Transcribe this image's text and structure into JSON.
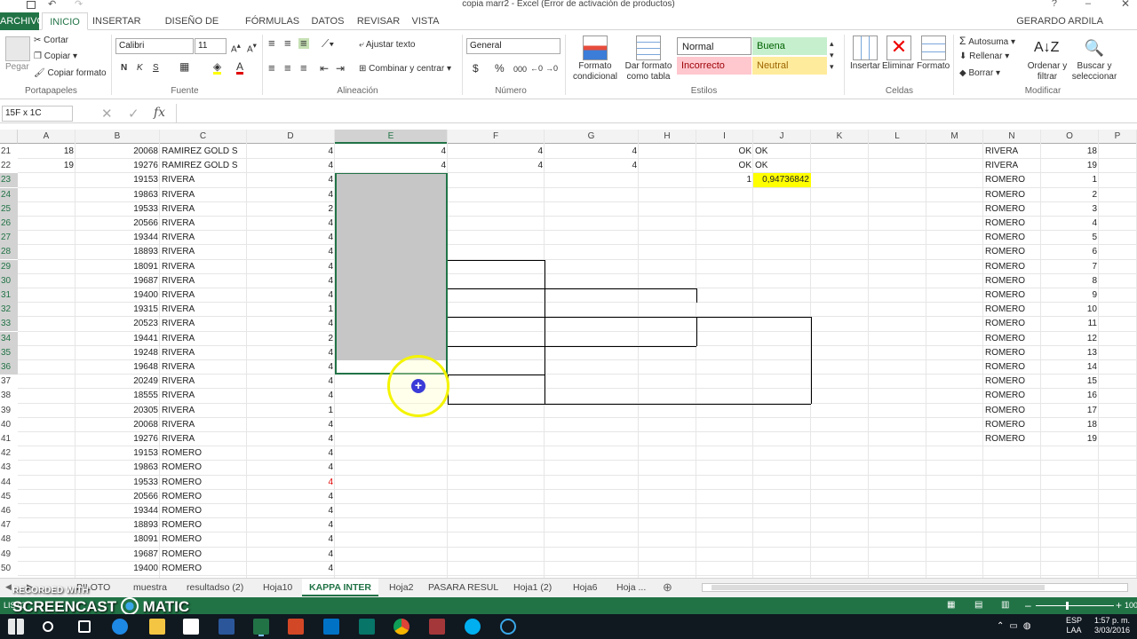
{
  "window": {
    "title": "copia marr2 - Excel (Error de activación de productos)",
    "user": "GERARDO ARDILA"
  },
  "tabs": [
    "ARCHIVO",
    "INICIO",
    "INSERTAR",
    "DISEÑO DE PÁGINA",
    "FÓRMULAS",
    "DATOS",
    "REVISAR",
    "VISTA"
  ],
  "ribbon": {
    "clipboard": {
      "paste": "Pegar",
      "cut": "Cortar",
      "copy": "Copiar",
      "format_painter": "Copiar formato",
      "label": "Portapapeles"
    },
    "font": {
      "name": "Calibri",
      "size": "11",
      "bold": "N",
      "italic": "K",
      "underline": "S",
      "label": "Fuente"
    },
    "alignment": {
      "wrap": "Ajustar texto",
      "merge": "Combinar y centrar",
      "label": "Alineación"
    },
    "number": {
      "format": "General",
      "currency": "$",
      "percent": "%",
      "thousands": "000",
      "label": "Número"
    },
    "styles": {
      "cond_format": "Formato condicional",
      "table_format": "Dar formato como tabla",
      "normal": "Normal",
      "good": "Buena",
      "bad": "Incorrecto",
      "neutral": "Neutral",
      "label": "Estilos"
    },
    "cells": {
      "insert": "Insertar",
      "delete": "Eliminar",
      "format": "Formato",
      "label": "Celdas"
    },
    "editing": {
      "autosum": "Autosuma",
      "fill": "Rellenar",
      "clear": "Borrar",
      "sort": "Ordenar y filtrar",
      "find": "Buscar y seleccionar",
      "label": "Modificar"
    }
  },
  "formula_bar": {
    "name_box": "15F x 1C",
    "fx": "fx",
    "content": ""
  },
  "columns": [
    "A",
    "B",
    "C",
    "D",
    "E",
    "F",
    "G",
    "H",
    "I",
    "J",
    "K",
    "L",
    "M",
    "N",
    "O",
    "P"
  ],
  "rows": [
    {
      "r": "21",
      "A": "18",
      "B": "20068",
      "C": "RAMIREZ GOLD S",
      "D": "4",
      "E": "4",
      "F": "4",
      "G": "4",
      "I": "OK",
      "J": "OK",
      "N": "RIVERA",
      "O": "18"
    },
    {
      "r": "22",
      "A": "19",
      "B": "19276",
      "C": "RAMIREZ GOLD S",
      "D": "4",
      "E": "4",
      "F": "4",
      "G": "4",
      "I": "OK",
      "J": "OK",
      "N": "RIVERA",
      "O": "19"
    },
    {
      "r": "23",
      "B": "19153",
      "C": "RIVERA",
      "D": "4",
      "I": "1",
      "J": "0,94736842",
      "N": "ROMERO",
      "O": "1"
    },
    {
      "r": "24",
      "B": "19863",
      "C": "RIVERA",
      "D": "4",
      "N": "ROMERO",
      "O": "2"
    },
    {
      "r": "25",
      "B": "19533",
      "C": "RIVERA",
      "D": "2",
      "N": "ROMERO",
      "O": "3"
    },
    {
      "r": "26",
      "B": "20566",
      "C": "RIVERA",
      "D": "4",
      "N": "ROMERO",
      "O": "4"
    },
    {
      "r": "27",
      "B": "19344",
      "C": "RIVERA",
      "D": "4",
      "N": "ROMERO",
      "O": "5"
    },
    {
      "r": "28",
      "B": "18893",
      "C": "RIVERA",
      "D": "4",
      "N": "ROMERO",
      "O": "6"
    },
    {
      "r": "29",
      "B": "18091",
      "C": "RIVERA",
      "D": "4",
      "N": "ROMERO",
      "O": "7"
    },
    {
      "r": "30",
      "B": "19687",
      "C": "RIVERA",
      "D": "4",
      "N": "ROMERO",
      "O": "8"
    },
    {
      "r": "31",
      "B": "19400",
      "C": "RIVERA",
      "D": "4",
      "N": "ROMERO",
      "O": "9"
    },
    {
      "r": "32",
      "B": "19315",
      "C": "RIVERA",
      "D": "1",
      "N": "ROMERO",
      "O": "10"
    },
    {
      "r": "33",
      "B": "20523",
      "C": "RIVERA",
      "D": "4",
      "N": "ROMERO",
      "O": "11"
    },
    {
      "r": "34",
      "B": "19441",
      "C": "RIVERA",
      "D": "2",
      "N": "ROMERO",
      "O": "12"
    },
    {
      "r": "35",
      "B": "19248",
      "C": "RIVERA",
      "D": "4",
      "N": "ROMERO",
      "O": "13"
    },
    {
      "r": "36",
      "B": "19648",
      "C": "RIVERA",
      "D": "4",
      "N": "ROMERO",
      "O": "14"
    },
    {
      "r": "37",
      "B": "20249",
      "C": "RIVERA",
      "D": "4",
      "N": "ROMERO",
      "O": "15"
    },
    {
      "r": "38",
      "B": "18555",
      "C": "RIVERA",
      "D": "4",
      "N": "ROMERO",
      "O": "16"
    },
    {
      "r": "39",
      "B": "20305",
      "C": "RIVERA",
      "D": "1",
      "N": "ROMERO",
      "O": "17"
    },
    {
      "r": "40",
      "B": "20068",
      "C": "RIVERA",
      "D": "4",
      "N": "ROMERO",
      "O": "18"
    },
    {
      "r": "41",
      "B": "19276",
      "C": "RIVERA",
      "D": "4",
      "N": "ROMERO",
      "O": "19"
    },
    {
      "r": "42",
      "B": "19153",
      "C": "ROMERO",
      "D": "4"
    },
    {
      "r": "43",
      "B": "19863",
      "C": "ROMERO",
      "D": "4"
    },
    {
      "r": "44",
      "B": "19533",
      "C": "ROMERO",
      "D": "4",
      "red": true
    },
    {
      "r": "45",
      "B": "20566",
      "C": "ROMERO",
      "D": "4"
    },
    {
      "r": "46",
      "B": "19344",
      "C": "ROMERO",
      "D": "4"
    },
    {
      "r": "47",
      "B": "18893",
      "C": "ROMERO",
      "D": "4"
    },
    {
      "r": "48",
      "B": "18091",
      "C": "ROMERO",
      "D": "4"
    },
    {
      "r": "49",
      "B": "19687",
      "C": "ROMERO",
      "D": "4"
    },
    {
      "r": "50",
      "B": "19400",
      "C": "ROMERO",
      "D": "4"
    }
  ],
  "sheets": [
    "PILOTO",
    "muestra",
    "resultadso (2)",
    "Hoja10",
    "KAPPA INTER",
    "Hoja2",
    "PASARA RESUL",
    "Hoja1 (2)",
    "Hoja6",
    "Hoja ..."
  ],
  "active_sheet": "KAPPA INTER",
  "status": {
    "ready": "LISTO",
    "zoom": "100"
  },
  "watermark": {
    "recorded": "RECORDED WITH",
    "brand": "SCREENCAST",
    "brand2": "MATIC"
  },
  "clock": {
    "time": "1:57 p. m.",
    "date": "3/03/2016",
    "lang": "ESP",
    "region": "LAA"
  },
  "colors": {
    "excel_green": "#217346",
    "selection": "#c6c6c6",
    "highlight": "#ffff00",
    "red_value": "#e00000"
  }
}
